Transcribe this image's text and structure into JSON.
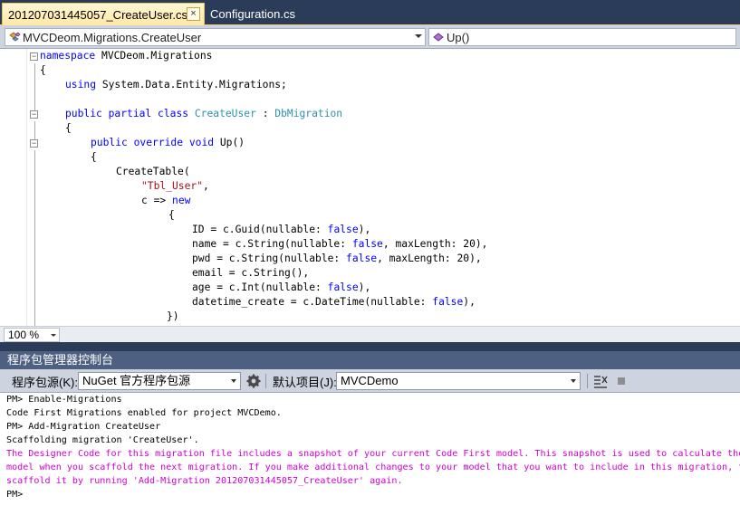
{
  "tabs": [
    {
      "label": "201207031445057_CreateUser.cs",
      "active": true
    },
    {
      "label": "Configuration.cs",
      "active": false
    }
  ],
  "tab_close_glyph": "×",
  "navigation": {
    "type_combo": "MVCDeom.Migrations.CreateUser",
    "member_combo": "Up()"
  },
  "code": {
    "line1": {
      "kw": "namespace",
      "rest": " MVCDeom.Migrations"
    },
    "line2": "{",
    "line3": {
      "kw": "using",
      "rest": " System.Data.Entity.Migrations;"
    },
    "line4": {
      "kw1": "public",
      "kw2": "partial",
      "kw3": "class",
      "type1": "CreateUser",
      "sep": " : ",
      "type2": "DbMigration"
    },
    "line5": "{",
    "line6": {
      "kw1": "public",
      "kw2": "override",
      "kw3": "void",
      "rest": " Up()"
    },
    "line7": "{",
    "line8": "CreateTable(",
    "line9": {
      "str": "\"Tbl_User\"",
      "rest": ","
    },
    "line10": {
      "pre": "c => ",
      "kw": "new"
    },
    "line11": "{",
    "line12": {
      "pre": "ID = c.Guid(nullable: ",
      "kw": "false",
      "post": "),"
    },
    "line13": {
      "pre": "name = c.String(nullable: ",
      "kw": "false",
      "post": ", maxLength: 20),"
    },
    "line14": {
      "pre": "pwd = c.String(nullable: ",
      "kw": "false",
      "post": ", maxLength: 20),"
    },
    "line15": "email = c.String(),",
    "line16": {
      "pre": "age = c.Int(nullable: ",
      "kw": "false",
      "post": "),"
    },
    "line17": {
      "pre": "datetime_create = c.DateTime(nullable: ",
      "kw": "false",
      "post": "),"
    },
    "line18": "})"
  },
  "zoom": "100 %",
  "tool_window_title": "程序包管理器控制台",
  "console_toolbar": {
    "source_label": "程序包源(K):",
    "source_value": "NuGet 官方程序包源",
    "project_label": "默认项目(J):",
    "project_value": "MVCDemo",
    "settings_icon": "gear-icon",
    "clear_icon": "clear-console-icon",
    "stop_icon": "stop-icon"
  },
  "console": [
    {
      "text": "PM> Enable-Migrations",
      "kind": "normal"
    },
    {
      "text": "Code First Migrations enabled for project MVCDemo.",
      "kind": "normal"
    },
    {
      "text": "PM> Add-Migration CreateUser",
      "kind": "normal"
    },
    {
      "text": "Scaffolding migration 'CreateUser'.",
      "kind": "normal"
    },
    {
      "text": "The Designer Code for this migration file includes a snapshot of your current Code First model. This snapshot is used to calculate the",
      "kind": "warning"
    },
    {
      "text": "model when you scaffold the next migration. If you make additional changes to your model that you want to include in this migration, th",
      "kind": "warning"
    },
    {
      "text": "scaffold it by running 'Add-Migration 201207031445057_CreateUser' again.",
      "kind": "warning"
    },
    {
      "text": "PM>",
      "kind": "normal"
    }
  ],
  "colors": {
    "keyword": "#0000ff",
    "type": "#2b91af",
    "string": "#a31515",
    "console_warning": "#d000d0",
    "chrome_dark": "#2b3c59",
    "tool_header": "#4d6082"
  }
}
